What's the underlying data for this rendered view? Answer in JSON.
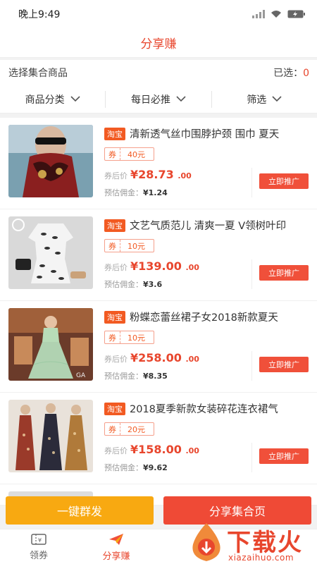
{
  "status": {
    "time": "晚上9:49"
  },
  "header": {
    "title": "分享赚"
  },
  "selection": {
    "label": "选择集合商品",
    "selected_label": "已选：",
    "selected_count": "0"
  },
  "filters": [
    {
      "label": "商品分类"
    },
    {
      "label": "每日必推"
    },
    {
      "label": "筛选"
    }
  ],
  "products": [
    {
      "tag": "淘宝",
      "title": "清新透气丝巾围脖护颈 围巾 夏天",
      "coupon_label": "券",
      "coupon_value": "40元",
      "price_label": "券后价",
      "price_main": "¥28.73",
      "price_decimal": ".00",
      "commission_label": "预估佣金：",
      "commission": "¥1.24",
      "button": "立即推广"
    },
    {
      "tag": "淘宝",
      "title": "文艺气质范儿 清爽一夏 V领树叶印",
      "coupon_label": "券",
      "coupon_value": "10元",
      "price_label": "券后价",
      "price_main": "¥139.00",
      "price_decimal": ".00",
      "commission_label": "预估佣金：",
      "commission": "¥3.6",
      "button": "立即推广"
    },
    {
      "tag": "淘宝",
      "title": "粉蝶恋蕾丝裙子女2018新款夏天",
      "coupon_label": "券",
      "coupon_value": "10元",
      "price_label": "券后价",
      "price_main": "¥258.00",
      "price_decimal": ".00",
      "commission_label": "预估佣金：",
      "commission": "¥8.35",
      "button": "立即推广"
    },
    {
      "tag": "淘宝",
      "title": "2018夏季新款女装碎花连衣裙气",
      "coupon_label": "券",
      "coupon_value": "20元",
      "price_label": "券后价",
      "price_main": "¥158.00",
      "price_decimal": ".00",
      "commission_label": "预估佣金：",
      "commission": "¥9.62",
      "button": "立即推广"
    }
  ],
  "actions": {
    "one_click": "一键群发",
    "share": "分享集合页"
  },
  "tabs": [
    {
      "label": "领券",
      "icon": "coupon-icon"
    },
    {
      "label": "分享赚",
      "icon": "share-plane-icon"
    }
  ],
  "watermark": {
    "text": "下载火",
    "url": "xiazaihuo.com"
  },
  "colors": {
    "accent": "#e8462d",
    "orange": "#f8a911",
    "tag": "#f25a22"
  }
}
